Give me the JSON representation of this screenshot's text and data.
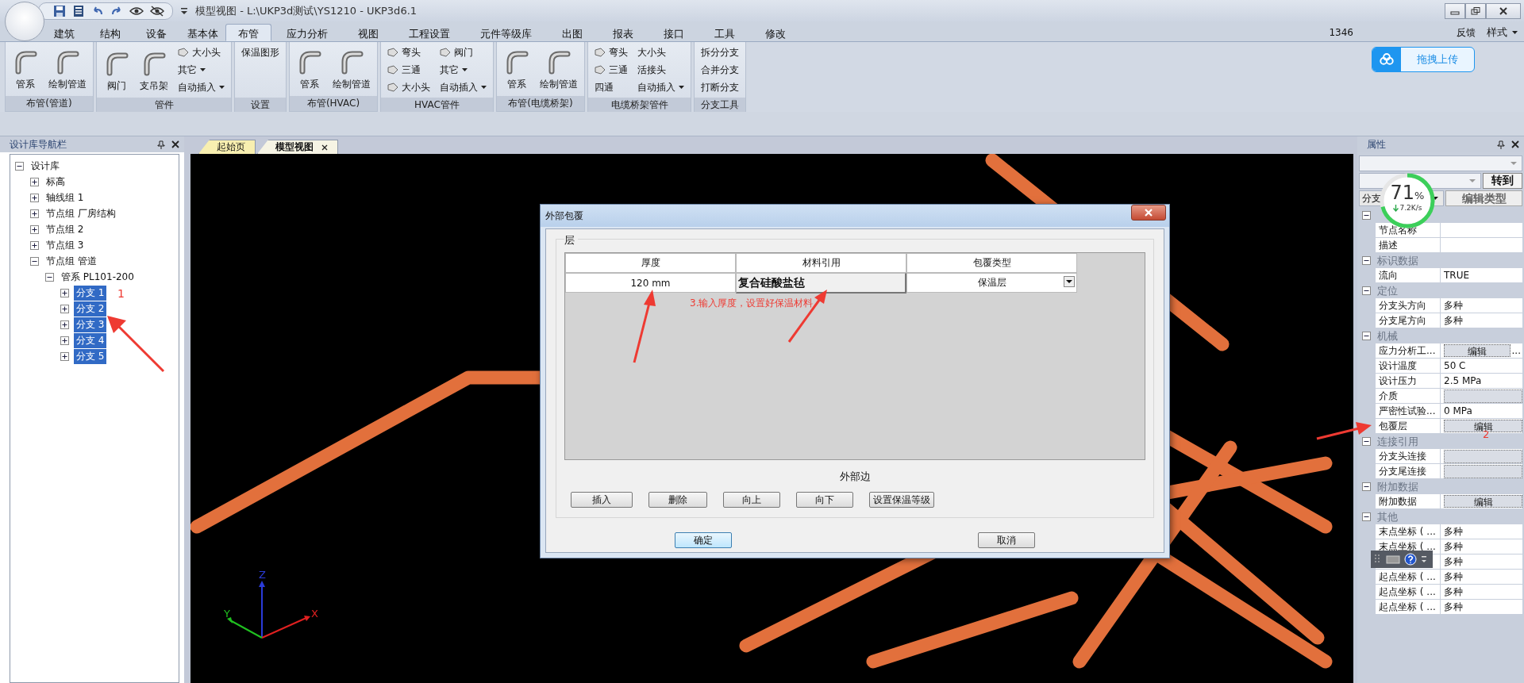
{
  "window": {
    "title": "模型视图 - L:\\UKP3d测试\\YS1210 - UKP3d6.1"
  },
  "ribbon_tabs": [
    {
      "label": "建筑",
      "selected": false
    },
    {
      "label": "结构",
      "selected": false
    },
    {
      "label": "设备",
      "selected": false
    },
    {
      "label": "基本体",
      "selected": false
    },
    {
      "label": "布管",
      "selected": true
    },
    {
      "label": "应力分析",
      "selected": false
    },
    {
      "label": "视图",
      "selected": false
    },
    {
      "label": "工程设置",
      "selected": false
    },
    {
      "label": "元件等级库",
      "selected": false
    },
    {
      "label": "出图",
      "selected": false
    },
    {
      "label": "报表",
      "selected": false
    },
    {
      "label": "接口",
      "selected": false
    },
    {
      "label": "工具",
      "selected": false
    },
    {
      "label": "修改",
      "selected": false
    }
  ],
  "tab_bar_right": {
    "number": "1346",
    "feedback": "反馈",
    "style": "样式"
  },
  "upload_widget": {
    "label": "拖拽上传"
  },
  "ribbon_groups": [
    {
      "label": "布管(管道)",
      "items": [
        {
          "kind": "large",
          "label": "管系",
          "icon": true
        },
        {
          "kind": "large",
          "label": "绘制管道",
          "icon": true
        }
      ]
    },
    {
      "label": "管件",
      "items": [
        {
          "kind": "large",
          "label": "阀门",
          "icon": true
        },
        {
          "kind": "large",
          "label": "支吊架",
          "icon": true
        },
        {
          "kind": "small",
          "label": "大小头",
          "icon": true,
          "dropdown": false
        },
        {
          "kind": "small",
          "label": "其它",
          "icon": false,
          "dropdown": true
        },
        {
          "kind": "small",
          "label": "自动插入",
          "icon": false,
          "dropdown": true
        }
      ]
    },
    {
      "label": "设置",
      "items": [
        {
          "kind": "small",
          "label": "保温图形",
          "icon": false,
          "dropdown": false
        }
      ]
    },
    {
      "label": "布管(HVAC)",
      "items": [
        {
          "kind": "large",
          "label": "管系",
          "icon": true
        },
        {
          "kind": "large",
          "label": "绘制管道",
          "icon": true
        }
      ]
    },
    {
      "label": "HVAC管件",
      "items": [
        {
          "kind": "small",
          "label": "弯头",
          "icon": true,
          "dropdown": false
        },
        {
          "kind": "small",
          "label": "三通",
          "icon": true,
          "dropdown": false
        },
        {
          "kind": "small",
          "label": "大小头",
          "icon": true,
          "dropdown": false
        },
        {
          "kind": "small",
          "label": "阀门",
          "icon": true,
          "dropdown": false
        },
        {
          "kind": "small",
          "label": "其它",
          "icon": false,
          "dropdown": true
        },
        {
          "kind": "small",
          "label": "自动插入",
          "icon": false,
          "dropdown": true
        }
      ]
    },
    {
      "label": "布管(电缆桥架)",
      "items": [
        {
          "kind": "large",
          "label": "管系",
          "icon": true
        },
        {
          "kind": "large",
          "label": "绘制管道",
          "icon": true
        }
      ]
    },
    {
      "label": "电缆桥架管件",
      "items": [
        {
          "kind": "small",
          "label": "弯头",
          "icon": true,
          "dropdown": false
        },
        {
          "kind": "small",
          "label": "三通",
          "icon": true,
          "dropdown": false
        },
        {
          "kind": "small",
          "label": "四通",
          "icon": false,
          "dropdown": false
        },
        {
          "kind": "small",
          "label": "大小头",
          "icon": false,
          "dropdown": false
        },
        {
          "kind": "small",
          "label": "活接头",
          "icon": false,
          "dropdown": false
        },
        {
          "kind": "small",
          "label": "自动插入",
          "icon": false,
          "dropdown": true
        }
      ]
    },
    {
      "label": "分支工具",
      "items": [
        {
          "kind": "small",
          "label": "拆分分支",
          "icon": false,
          "dropdown": false
        },
        {
          "kind": "small",
          "label": "合并分支",
          "icon": false,
          "dropdown": false
        },
        {
          "kind": "small",
          "label": "打断分支",
          "icon": false,
          "dropdown": false
        }
      ]
    }
  ],
  "tree": {
    "title": "设计库导航栏",
    "items": [
      {
        "label": "设计库",
        "expanded": true,
        "selected": false,
        "children": [
          {
            "label": "标高",
            "expanded": false,
            "selected": false
          },
          {
            "label": "轴线组 1",
            "expanded": false,
            "selected": false
          },
          {
            "label": "节点组 厂房结构",
            "expanded": false,
            "selected": false
          },
          {
            "label": "节点组 2",
            "expanded": false,
            "selected": false
          },
          {
            "label": "节点组 3",
            "expanded": false,
            "selected": false
          },
          {
            "label": "节点组 管道",
            "expanded": true,
            "selected": false,
            "children": [
              {
                "label": "管系 PL101-200",
                "expanded": true,
                "selected": false,
                "children": [
                  {
                    "label": "分支 1",
                    "expanded": false,
                    "selected": true
                  },
                  {
                    "label": "分支 2",
                    "expanded": false,
                    "selected": true
                  },
                  {
                    "label": "分支 3",
                    "expanded": false,
                    "selected": true
                  },
                  {
                    "label": "分支 4",
                    "expanded": false,
                    "selected": true
                  },
                  {
                    "label": "分支 5",
                    "expanded": false,
                    "selected": true
                  }
                ]
              }
            ]
          }
        ]
      }
    ]
  },
  "doc_tabs": [
    {
      "label": "起始页",
      "selected": false
    },
    {
      "label": "模型视图",
      "selected": true
    }
  ],
  "viewport": {
    "axes": [
      "Z",
      "Y",
      "X"
    ]
  },
  "dialog": {
    "title": "外部包覆",
    "group": "层",
    "columns": [
      "厚度",
      "材料引用",
      "包覆类型"
    ],
    "rows": [
      [
        "120 mm",
        "复合硅酸盐毡",
        "保温层"
      ]
    ],
    "footer": "外部边",
    "buttons": [
      "插入",
      "删除",
      "向上",
      "向下",
      "设置保温等级"
    ],
    "actions": [
      {
        "label": "确定",
        "default": true
      },
      {
        "label": "取消",
        "default": false
      }
    ]
  },
  "properties": {
    "title": "属性",
    "goto": "转到",
    "category": "分支",
    "edit_type": "编辑类型",
    "sections": [
      {
        "expanded": true,
        "rows": [
          {
            "kind": "text",
            "label": "节点名称"
          },
          {
            "kind": "text",
            "label": "描述"
          }
        ]
      },
      {
        "name": "标识数据",
        "expanded": true,
        "rows": [
          {
            "kind": "text",
            "label": "流向",
            "value": "TRUE"
          }
        ]
      },
      {
        "name": "定位",
        "expanded": true,
        "rows": [
          {
            "kind": "text",
            "label": "分支头方向",
            "value": "多种"
          },
          {
            "kind": "text",
            "label": "分支尾方向",
            "value": "多种"
          }
        ]
      },
      {
        "name": "机械",
        "expanded": true,
        "rows": [
          {
            "kind": "button",
            "label": "应力分析工...",
            "value": "编辑",
            "ellipsis": "..."
          },
          {
            "kind": "text",
            "label": "设计温度",
            "value": "50 C"
          },
          {
            "kind": "text",
            "label": "设计压力",
            "value": "2.5 MPa"
          },
          {
            "kind": "blank",
            "label": "介质"
          },
          {
            "kind": "text",
            "label": "严密性试验...",
            "value": "0 MPa"
          },
          {
            "kind": "button",
            "label": "包覆层",
            "value": "编辑"
          }
        ]
      },
      {
        "name": "连接引用",
        "expanded": true,
        "rows": [
          {
            "kind": "blank",
            "label": "分支头连接"
          },
          {
            "kind": "blank",
            "label": "分支尾连接"
          }
        ]
      },
      {
        "name": "附加数据",
        "expanded": true,
        "rows": [
          {
            "kind": "button",
            "label": "附加数据",
            "value": "编辑"
          }
        ]
      },
      {
        "name": "其他",
        "expanded": true,
        "rows": [
          {
            "kind": "text",
            "label": "末点坐标 ( ...",
            "value": "多种"
          },
          {
            "kind": "text",
            "label": "末点坐标 ( ...",
            "value": "多种"
          },
          {
            "kind": "text",
            "label": "",
            "value": "多种"
          },
          {
            "kind": "text",
            "label": "起点坐标 ( ...",
            "value": "多种"
          },
          {
            "kind": "text",
            "label": "起点坐标 ( ...",
            "value": "多种"
          },
          {
            "kind": "text",
            "label": "起点坐标 ( ...",
            "value": "多种"
          }
        ]
      }
    ]
  },
  "speed_widget": {
    "percent": "71",
    "unit": "%",
    "rate": "7.2K/s",
    "level": 0.71
  },
  "annotations": [
    "1",
    "2",
    "3.输入厚度，设置好保温材料"
  ]
}
